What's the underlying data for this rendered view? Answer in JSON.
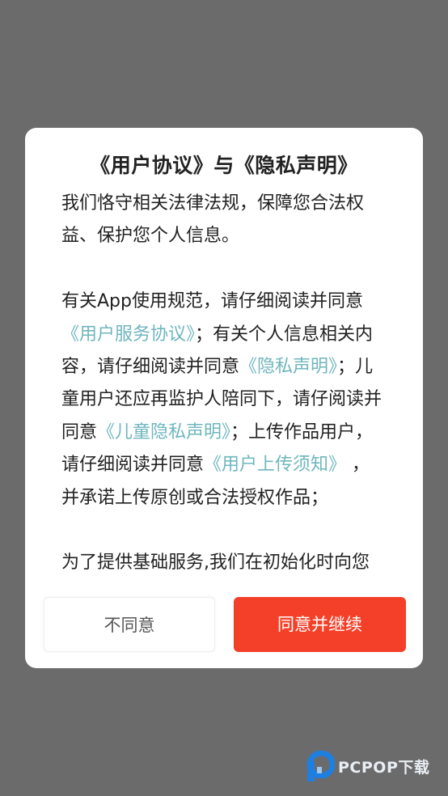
{
  "dialog": {
    "title": "《用户协议》与《隐私声明》",
    "paragraph1": "我们恪守相关法律法规，保障您合法权益、保护您个人信息。",
    "paragraph2": {
      "intro": "有关App使用规范，请仔细阅读并同意",
      "link_user_service": "《用户服务协议》",
      "text_2": "；有关个人信息相关内容，请仔细阅读并同意",
      "link_privacy": "《隐私声明》",
      "text_3": "；儿童用户还应再监护人陪同下，请仔阅读并同意",
      "link_child_privacy": "《儿童隐私声明》",
      "text_4": "；上传作品用户，请仔细阅读并同意",
      "link_upload_notice": "《用户上传须知》",
      "text_5": " ，并承诺上传原创或合法授权作品；"
    },
    "paragraph3": "为了提供基础服务,我们在初始化时向您"
  },
  "buttons": {
    "disagree": "不同意",
    "agree": "同意并继续"
  },
  "watermark": {
    "text": "PCPOP下载"
  },
  "colors": {
    "overlay": "#6b6b6b",
    "link": "#6fb6be",
    "agree_button": "#f54029",
    "watermark_blue": "#1f7fe0"
  }
}
